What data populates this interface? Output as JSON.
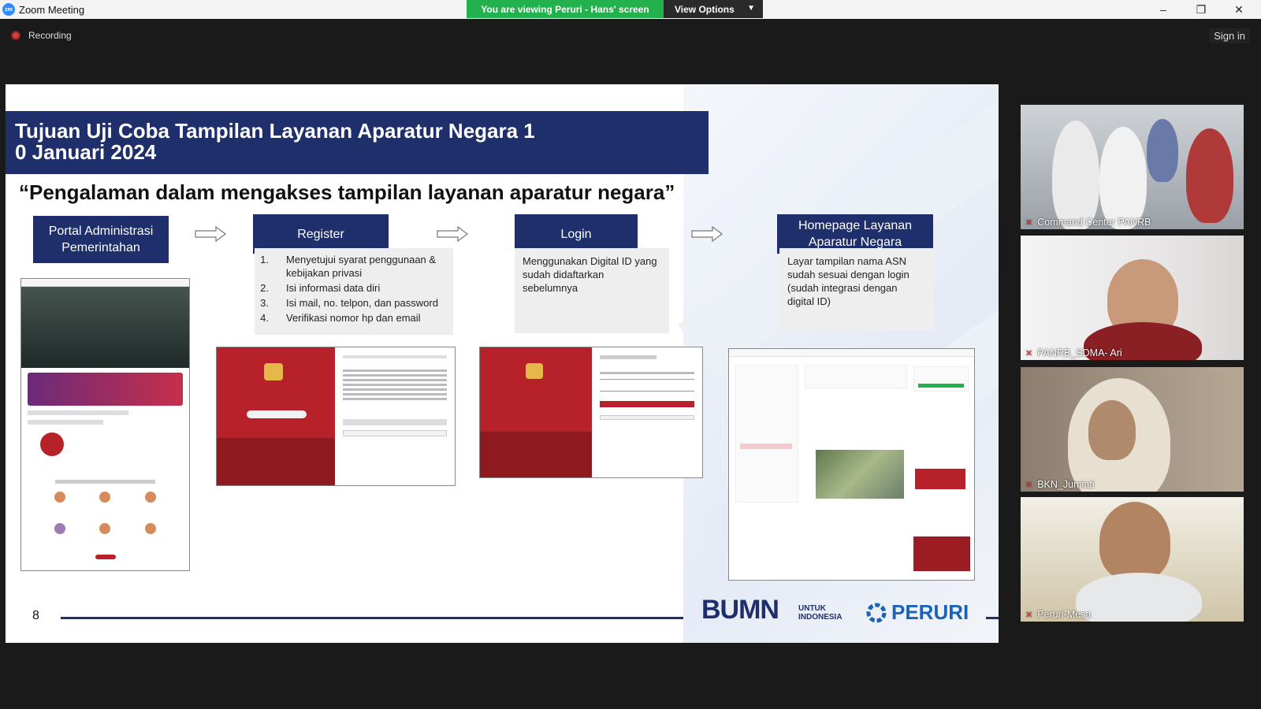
{
  "window": {
    "title": "Zoom Meeting",
    "share_banner": "You are viewing Peruri - Hans' screen",
    "view_options": "View Options"
  },
  "topbar": {
    "recording": "Recording",
    "sign_in": "Sign in"
  },
  "slide": {
    "title": "Tujuan Uji Coba Tampilan Layanan Aparatur Negara 1\n0 Januari 2024",
    "subtitle": "“Pengalaman dalam mengakses tampilan layanan aparatur negara”",
    "steps": [
      {
        "title": "Portal Administrasi Pemerintahan"
      },
      {
        "title": "Register",
        "items": [
          {
            "n": "1.",
            "text": "Menyetujui syarat penggunaan & kebijakan  privasi"
          },
          {
            "n": "2.",
            "text": "Isi informasi data diri"
          },
          {
            "n": "3.",
            "text": "Isi mail, no. telpon, dan password"
          },
          {
            "n": "4.",
            "text": "Verifikasi nomor hp dan email"
          }
        ]
      },
      {
        "title": "Login",
        "text": "Menggunakan Digital ID yang sudah didaftarkan sebelumnya"
      },
      {
        "title": "Homepage Layanan Aparatur Negara",
        "text": "Layar tampilan nama ASN sudah sesuai dengan login (sudah integrasi dengan digital ID)"
      }
    ],
    "page_number": "8",
    "footer": {
      "bumn": "BUMN",
      "bumn_sub1": "UNTUK",
      "bumn_sub2": "INDONESIA",
      "peruri": "PERURI"
    }
  },
  "participants": [
    {
      "name": "Command Center PANRB"
    },
    {
      "name": "PANRB_SDMA- Ari"
    },
    {
      "name": "BKN_Jumiati"
    },
    {
      "name": "Peruri-Mesa"
    }
  ],
  "colors": {
    "navy": "#1f2f6b",
    "green": "#22b14c",
    "red": "#b7222a"
  }
}
